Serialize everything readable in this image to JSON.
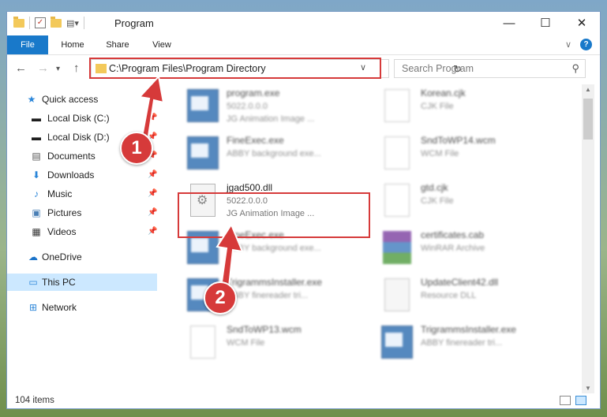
{
  "window": {
    "title": "Program",
    "controls": {
      "minimize": "—",
      "maximize": "☐",
      "close": "✕"
    }
  },
  "ribbon": {
    "tabs": [
      "File",
      "Home",
      "Share",
      "View"
    ],
    "help": "?",
    "collapse": "∨"
  },
  "address": {
    "path": "C:\\Program Files\\Program Directory",
    "search_placeholder": "Search Program"
  },
  "nav": {
    "quick_access": "Quick access",
    "items": [
      {
        "label": "Local Disk (C:)",
        "icon": "drive-icon",
        "pinned": true
      },
      {
        "label": "Local Disk (D:)",
        "icon": "drive-icon",
        "pinned": true
      },
      {
        "label": "Documents",
        "icon": "documents-icon",
        "pinned": true
      },
      {
        "label": "Downloads",
        "icon": "downloads-icon",
        "pinned": true
      },
      {
        "label": "Music",
        "icon": "music-icon",
        "pinned": true
      },
      {
        "label": "Pictures",
        "icon": "pictures-icon",
        "pinned": true
      },
      {
        "label": "Videos",
        "icon": "videos-icon",
        "pinned": true
      }
    ],
    "onedrive": "OneDrive",
    "this_pc": "This PC",
    "network": "Network"
  },
  "files": [
    {
      "name": "program.exe",
      "sub": "5022.0.0.0",
      "desc": "JG Animation Image ...",
      "icon": "exe-file-icon"
    },
    {
      "name": "Korean.cjk",
      "sub": "CJK File",
      "desc": "",
      "icon": "document-icon"
    },
    {
      "name": "FineExec.exe",
      "sub": "ABBY background exe...",
      "desc": "",
      "icon": "exe-file-icon"
    },
    {
      "name": "SndToWP14.wcm",
      "sub": "WCM File",
      "desc": "",
      "icon": "document-icon"
    },
    {
      "name": "jgad500.dll",
      "sub": "5022.0.0.0",
      "desc": "JG Animation Image ...",
      "icon": "dll-file-icon"
    },
    {
      "name": "gtd.cjk",
      "sub": "CJK File",
      "desc": "",
      "icon": "document-icon"
    },
    {
      "name": "FineExec.exe",
      "sub": "ABBY background exe...",
      "desc": "",
      "icon": "exe-file-icon"
    },
    {
      "name": "certificates.cab",
      "sub": "WinRAR Archive",
      "desc": "",
      "icon": "winrar-archive-icon"
    },
    {
      "name": "TrigrammsInstaller.exe",
      "sub": "ABBY finereader tri...",
      "desc": "",
      "icon": "exe-file-icon"
    },
    {
      "name": "UpdateClient42.dll",
      "sub": "Resource DLL",
      "desc": "",
      "icon": "dll-file-icon"
    },
    {
      "name": "SndToWP13.wcm",
      "sub": "WCM File",
      "desc": "",
      "icon": "document-icon"
    },
    {
      "name": "TrigrammsInstaller.exe",
      "sub": "ABBY finereader tri...",
      "desc": "",
      "icon": "exe-file-icon"
    }
  ],
  "annotations": {
    "step1": "1",
    "step2": "2"
  },
  "status": {
    "count": "104 items"
  },
  "colors": {
    "accent": "#1979ca",
    "highlight": "#d63a3a",
    "selected": "#cce8ff"
  }
}
